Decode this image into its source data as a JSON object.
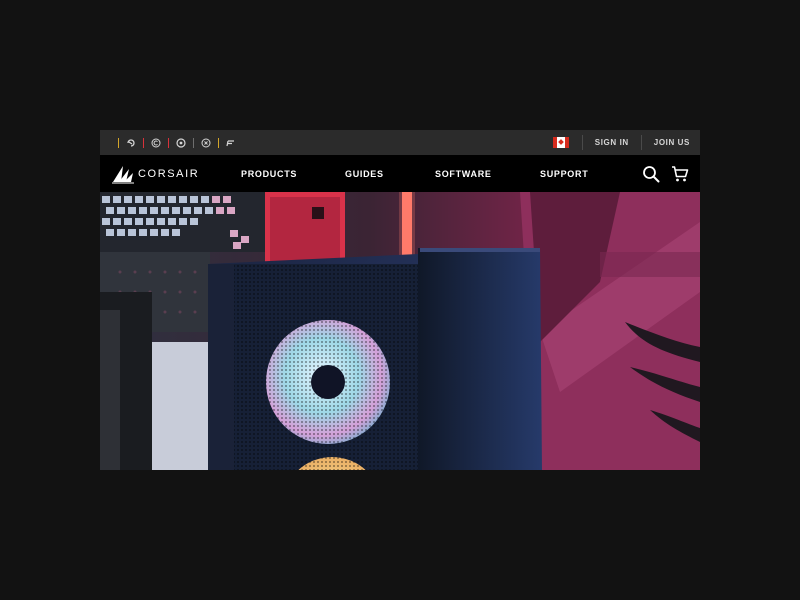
{
  "utility_bar": {
    "brand_icons": [
      "elgato-icon",
      "origin-icon",
      "scuf-icon",
      "drop-icon",
      "fanatec-icon"
    ],
    "region_flag": "canada-flag-icon",
    "sign_in_label": "SIGN IN",
    "join_us_label": "JOIN US"
  },
  "main_nav": {
    "logo_text": "CORSAIR",
    "items": [
      {
        "label": "PRODUCTS"
      },
      {
        "label": "GUIDES"
      },
      {
        "label": "SOFTWARE"
      },
      {
        "label": "SUPPORT"
      }
    ],
    "icons": [
      "search-icon",
      "cart-icon"
    ]
  },
  "colors": {
    "utility_bg": "#2b2b2b",
    "nav_bg": "#000000",
    "accent_yellow": "#d4a62a",
    "accent_red": "#d8323a"
  }
}
